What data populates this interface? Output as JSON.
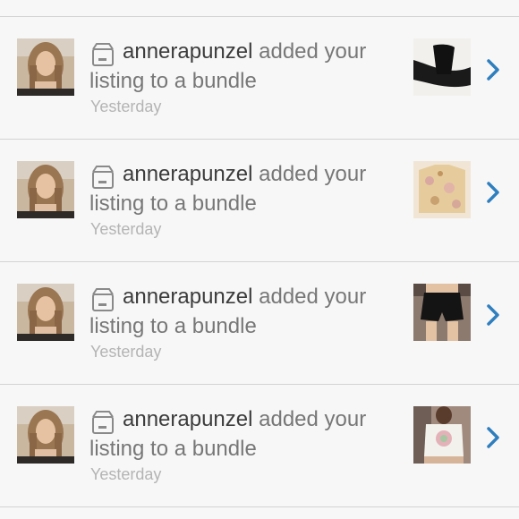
{
  "notifications": [
    {
      "username": "annerapunzel",
      "message": "added your listing to a bundle",
      "time": "Yesterday",
      "avatar_icon": "profile-photo-icon",
      "thumbnail_icon": "black-pants-photo-icon",
      "action_icon": "chevron-right-icon"
    },
    {
      "username": "annerapunzel",
      "message": "added your listing to a bundle",
      "time": "Yesterday",
      "avatar_icon": "profile-photo-icon",
      "thumbnail_icon": "floral-top-photo-icon",
      "action_icon": "chevron-right-icon"
    },
    {
      "username": "annerapunzel",
      "message": "added your listing to a bundle",
      "time": "Yesterday",
      "avatar_icon": "profile-photo-icon",
      "thumbnail_icon": "black-shorts-photo-icon",
      "action_icon": "chevron-right-icon"
    },
    {
      "username": "annerapunzel",
      "message": "added your listing to a bundle",
      "time": "Yesterday",
      "avatar_icon": "profile-photo-icon",
      "thumbnail_icon": "graphic-tee-photo-icon",
      "action_icon": "chevron-right-icon"
    }
  ],
  "colors": {
    "background": "#f7f7f7",
    "separator": "#d3d3d3",
    "username": "#3c3c3c",
    "message": "#777777",
    "timestamp": "#b4b4b4",
    "chevron": "#2f7fbf"
  }
}
